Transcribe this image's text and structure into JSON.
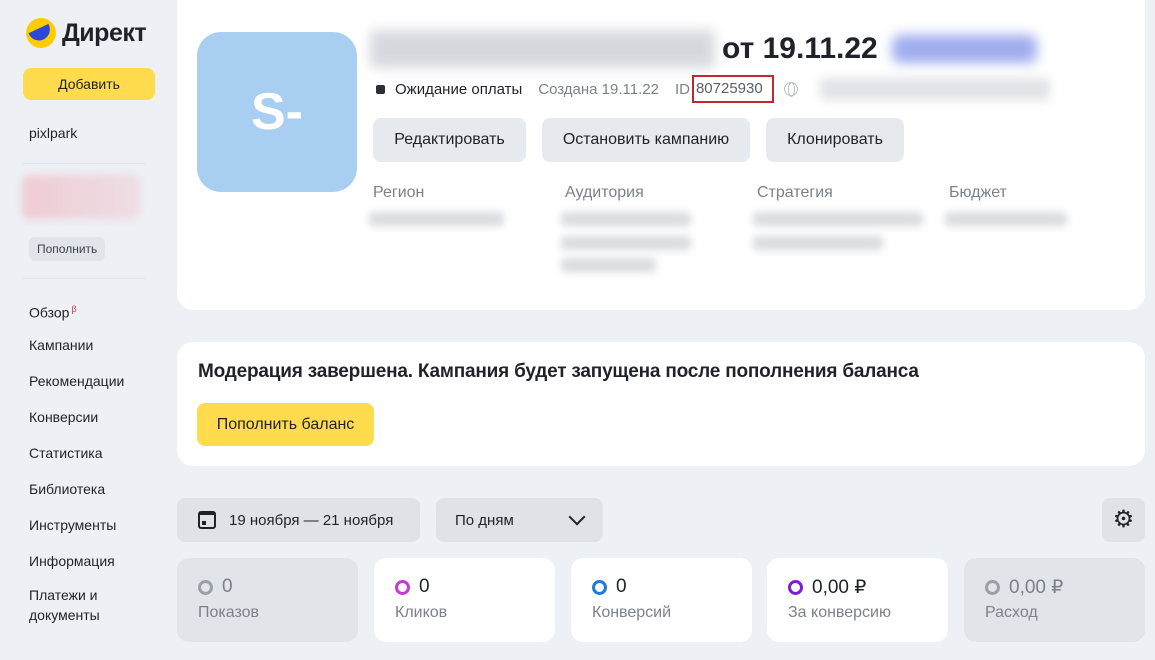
{
  "sidebar": {
    "logo": "Директ",
    "add_label": "Добавить",
    "account": "pixlpark",
    "topup_label": "Пополнить",
    "nav": [
      {
        "label": "Обзор",
        "badge": "β"
      },
      {
        "label": "Кампании"
      },
      {
        "label": "Рекомендации"
      },
      {
        "label": "Конверсии"
      },
      {
        "label": "Статистика"
      },
      {
        "label": "Библиотека"
      },
      {
        "label": "Инструменты"
      },
      {
        "label": "Информация"
      },
      {
        "label": "Платежи и документы"
      }
    ]
  },
  "campaign": {
    "avatar_text": "S-",
    "title_date": "от 19.11.22",
    "status": "Ожидание оплаты",
    "created": "Создана 19.11.22",
    "id_prefix": "ID",
    "id_value": "80725930",
    "buttons": {
      "edit": "Редактировать",
      "stop": "Остановить кампанию",
      "clone": "Клонировать"
    },
    "columns": [
      "Регион",
      "Аудитория",
      "Стратегия",
      "Бюджет"
    ]
  },
  "moderation": {
    "message": "Модерация завершена. Кампания будет запущена после пополнения баланса",
    "topup_label": "Пополнить баланс"
  },
  "controls": {
    "date_range": "19 ноября — 21 ноября",
    "period": "По дням"
  },
  "metrics": [
    {
      "value": "0",
      "label": "Показов",
      "color": "#9aa0a8",
      "active": false
    },
    {
      "value": "0",
      "label": "Кликов",
      "color": "#c23bd9",
      "active": true
    },
    {
      "value": "0",
      "label": "Конверсий",
      "color": "#1f7ae0",
      "active": true
    },
    {
      "value": "0,00 ₽",
      "label": "За конверсию",
      "color": "#7a1fd6",
      "active": true
    },
    {
      "value": "0,00 ₽",
      "label": "Расход",
      "color": "#9aa0a8",
      "active": false
    }
  ],
  "icons": {
    "calendar": "calendar-icon",
    "chevron": "chevron-down-icon",
    "settings": "gear-icon",
    "globe": "globe-icon"
  }
}
